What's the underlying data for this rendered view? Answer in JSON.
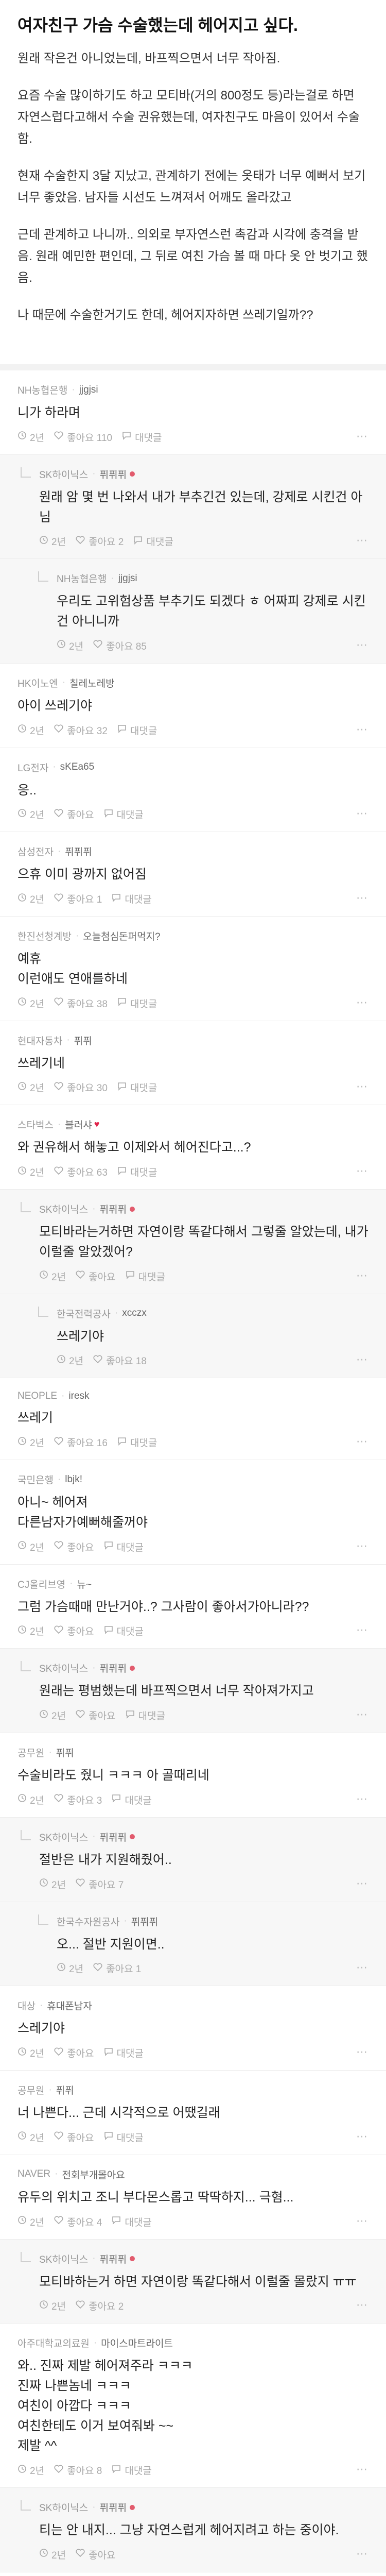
{
  "post": {
    "title": "여자친구 가슴 수술했는데 헤어지고 싶다.",
    "paragraphs": [
      "원래 작은건 아니었는데, 바프찍으면서 너무 작아짐.",
      "요즘 수술 많이하기도 하고 모티바(거의 800정도 등)라는걸로 하면 자연스럽다고해서 수술 권유했는데, 여자친구도 마음이 있어서 수술함.",
      "현재 수술한지 3달 지났고, 관계하기 전에는 옷태가 너무 예뻐서 보기 너무 좋았음. 남자들 시선도 느껴져서 어깨도 올라갔고",
      "근데 관계하고 나니까.. 의외로 부자연스런 촉감과 시각에 충격을 받음. 원래 예민한 편인데, 그 뒤로 여친 가슴 볼 때 마다 옷 안 벗기고 했음.",
      "나 때문에 수술한거기도 한데, 헤어지자하면 쓰레기일까??"
    ]
  },
  "comments": [
    {
      "company": "NH농협은행",
      "nick": "jjgjsi",
      "text": "니가 하라며",
      "time": "2년",
      "likes": "좋아요 110",
      "reply": "대댓글",
      "level": 0
    },
    {
      "company": "SK하이닉스",
      "nick": "퓌퓌퓌",
      "text": "원래 암 몇 번 나와서 내가 부추긴건 있는데, 강제로 시킨건 아님",
      "time": "2년",
      "likes": "좋아요 2",
      "reply": "대댓글",
      "level": 1,
      "badge": true
    },
    {
      "company": "NH농협은행",
      "nick": "jjgjsi",
      "text": "우리도 고위험상품 부추기도 되겠다 ㅎ 어짜피 강제로 시킨건 아니니까",
      "time": "2년",
      "likes": "좋아요 85",
      "reply": "",
      "level": 2
    },
    {
      "company": "HK이노엔",
      "nick": "칠레노레방",
      "text": "아이 쓰레기야",
      "time": "2년",
      "likes": "좋아요 32",
      "reply": "대댓글",
      "level": 0
    },
    {
      "company": "LG전자",
      "nick": "sKEa65",
      "text": "응..",
      "time": "2년",
      "likes": "좋아요",
      "reply": "대댓글",
      "level": 0
    },
    {
      "company": "삼성전자",
      "nick": "퓌퓌퓌",
      "text": "으휴 이미 광까지 없어짐",
      "time": "2년",
      "likes": "좋아요 1",
      "reply": "대댓글",
      "level": 0
    },
    {
      "company": "한진선청계방",
      "nick": "오늘첨심돈퍼먹지?",
      "text": "예휴\n이런애도 연애를하네",
      "time": "2년",
      "likes": "좋아요 38",
      "reply": "대댓글",
      "level": 0
    },
    {
      "company": "현대자동차",
      "nick": "퓌퓌",
      "text": "쓰레기네",
      "time": "2년",
      "likes": "좋아요 30",
      "reply": "대댓글",
      "level": 0
    },
    {
      "company": "스타벅스",
      "nick": "블러샤",
      "text": "와 권유해서 해놓고 이제와서 헤어진다고...?",
      "time": "2년",
      "likes": "좋아요 63",
      "reply": "대댓글",
      "level": 0,
      "heart": true
    },
    {
      "company": "SK하이닉스",
      "nick": "퓌퓌퓌",
      "text": "모티바라는거하면 자연이랑 똑같다해서 그렇줄 알았는데, 내가 이럴줄 알았겠어?",
      "time": "2년",
      "likes": "좋아요",
      "reply": "대댓글",
      "level": 1,
      "badge": true
    },
    {
      "company": "한국전력공사",
      "nick": "xcczx",
      "text": "쓰레기야",
      "time": "2년",
      "likes": "좋아요 18",
      "reply": "",
      "level": 2
    },
    {
      "company": "NEOPLE",
      "nick": "iresk",
      "text": "쓰레기",
      "time": "2년",
      "likes": "좋아요 16",
      "reply": "대댓글",
      "level": 0
    },
    {
      "company": "국민은행",
      "nick": "lbjk!",
      "text": "아니~ 헤어져\n다른남자가예뻐해줄꺼야",
      "time": "2년",
      "likes": "좋아요",
      "reply": "대댓글",
      "level": 0
    },
    {
      "company": "CJ올리브영",
      "nick": "뉴~",
      "text": "그럼 가슴때매 만난거야..? 그사람이 좋아서가아니라??",
      "time": "2년",
      "likes": "좋아요",
      "reply": "대댓글",
      "level": 0
    },
    {
      "company": "SK하이닉스",
      "nick": "퓌퓌퓌",
      "text": "원래는 평범했는데 바프찍으면서 너무 작아져가지고",
      "time": "2년",
      "likes": "좋아요",
      "reply": "대댓글",
      "level": 1,
      "badge": true
    },
    {
      "company": "공무원",
      "nick": "퓌퓌",
      "text": "수술비라도 줬니 ㅋㅋㅋ 아 골때리네",
      "time": "2년",
      "likes": "좋아요 3",
      "reply": "대댓글",
      "level": 0
    },
    {
      "company": "SK하이닉스",
      "nick": "퓌퓌퓌",
      "text": "절반은 내가 지원해줬어..",
      "time": "2년",
      "likes": "좋아요 7",
      "reply": "",
      "level": 1,
      "badge": true
    },
    {
      "company": "한국수자원공사",
      "nick": "퓌퓌퓌",
      "text": "오... 절반 지원이면..",
      "time": "2년",
      "likes": "좋아요 1",
      "reply": "",
      "level": 2
    },
    {
      "company": "대상",
      "nick": "휴대폰남자",
      "text": "스레기야",
      "time": "2년",
      "likes": "좋아요",
      "reply": "대댓글",
      "level": 0
    },
    {
      "company": "공무원",
      "nick": "퓌퓌",
      "text": "너 나쁜다... 근데 시각적으로 어땠길래",
      "time": "2년",
      "likes": "좋아요",
      "reply": "대댓글",
      "level": 0
    },
    {
      "company": "NAVER",
      "nick": "전회부개몰아요",
      "text": "유두의 위치고 조니 부다몬스롭고 딱딱하지... 극혐...",
      "time": "2년",
      "likes": "좋아요 4",
      "reply": "대댓글",
      "level": 0
    },
    {
      "company": "SK하이닉스",
      "nick": "퓌퓌퓌",
      "text": "모티바하는거 하면 자연이랑 똑같다해서 이럴줄 몰랐지 ㅠㅠ",
      "time": "2년",
      "likes": "좋아요 2",
      "reply": "",
      "level": 1,
      "badge": true
    },
    {
      "company": "아주대학교의료원",
      "nick": "마이스마트라이트",
      "text": "와.. 진짜 제발 헤어져주라 ㅋㅋㅋ\n진짜 나쁜놈네 ㅋㅋㅋ\n여친이 아깝다 ㅋㅋㅋ\n여친한테도 이거 보여줘봐 ~~\n제발 ^^",
      "time": "2년",
      "likes": "좋아요 8",
      "reply": "대댓글",
      "level": 0
    },
    {
      "company": "SK하이닉스",
      "nick": "퓌퓌퓌",
      "text": "티는 안 내지... 그냥 자연스럽게 헤어지려고 하는 중이야.",
      "time": "2년",
      "likes": "좋아요",
      "reply": "",
      "level": 1,
      "badge": true
    }
  ],
  "colors": {
    "badge": "#e25b6d",
    "heart": "#e0244b",
    "reply_bg": "#f7f7f7"
  }
}
